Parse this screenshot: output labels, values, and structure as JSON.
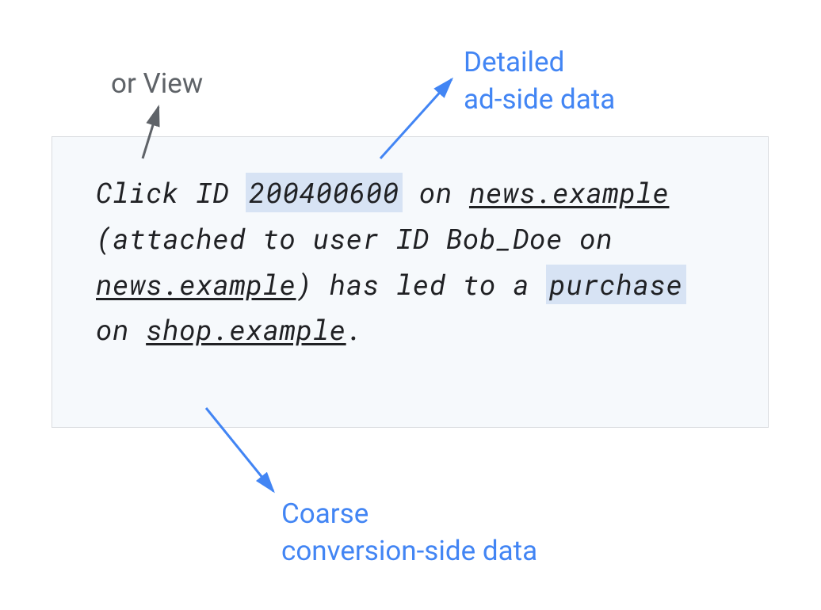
{
  "labels": {
    "orView": "or View",
    "detailedAdSide": "Detailed\nad-side data",
    "coarseConversionSide": "Coarse\nconversion-side data"
  },
  "report": {
    "part1": "Click ID ",
    "clickId": "200400600",
    "part2": " on ",
    "site1": "news.example",
    "part3": " (attached to user ID Bob_Doe on ",
    "site2": "news.example",
    "part4": ") has led to a ",
    "purchase": "purchase",
    "part5": " on ",
    "site3": "shop.example",
    "part6": "."
  },
  "colors": {
    "blue": "#4285f4",
    "gray": "#5f6368",
    "highlight": "#d7e3f4",
    "boxBg": "#f6f9fc",
    "boxBorder": "#dadce0"
  }
}
